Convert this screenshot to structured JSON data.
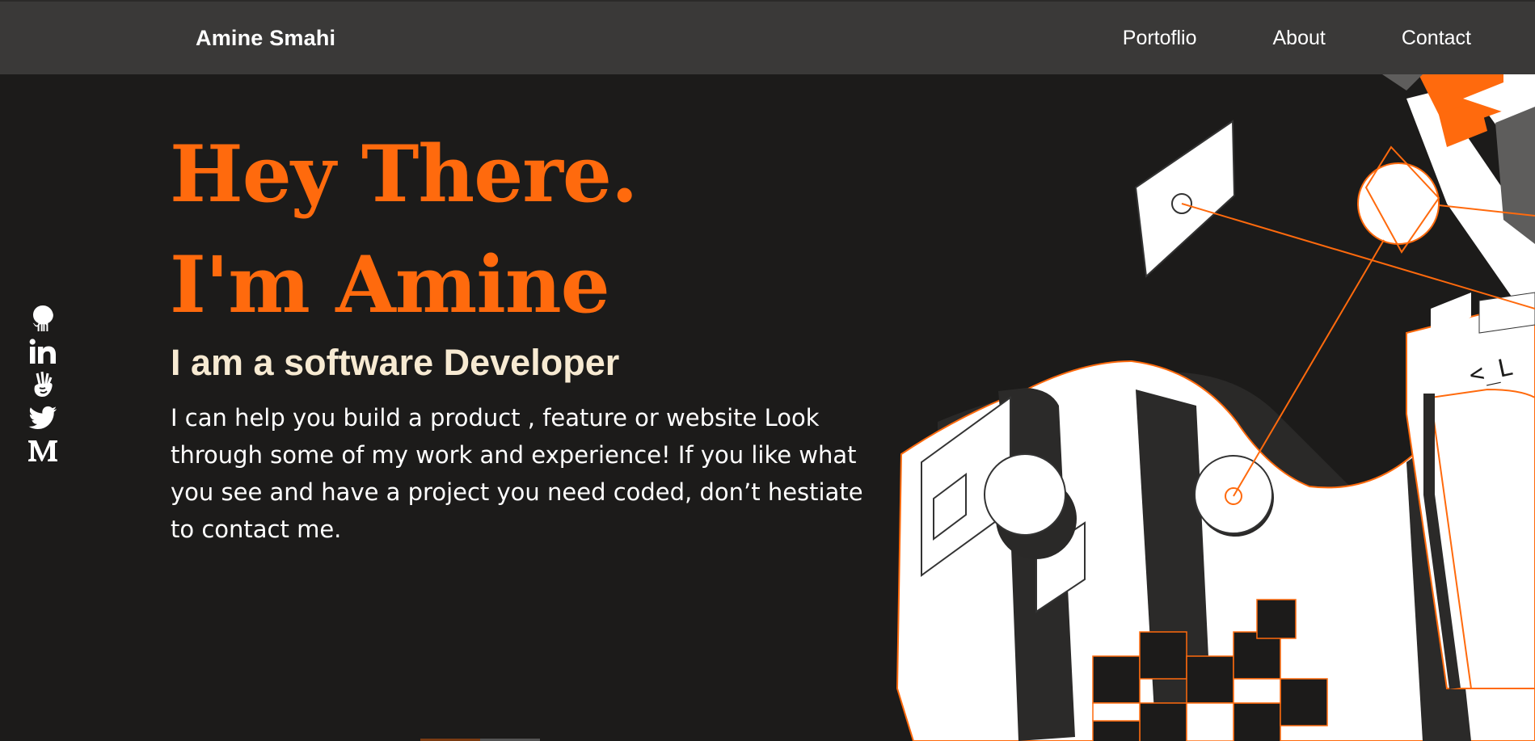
{
  "header": {
    "brand": "Amine Smahi",
    "nav": [
      {
        "label": "Portoflio"
      },
      {
        "label": "About"
      },
      {
        "label": "Contact"
      }
    ]
  },
  "social": [
    {
      "icon": "github-icon"
    },
    {
      "icon": "linkedin-icon"
    },
    {
      "icon": "angellist-icon"
    },
    {
      "icon": "twitter-icon"
    },
    {
      "icon": "medium-icon"
    }
  ],
  "hero": {
    "line1": "Hey There.",
    "line2": "I'm Amine",
    "subtitle": "I am a software Developer",
    "description": "I can help you build a product , feature or website Look through some of my work and experience! If you like what you see and have a project you need coded, don’t hestiate to contact me."
  },
  "colors": {
    "accent": "#ff6a0d",
    "background": "#1c1b1a",
    "navbar": "#3a3938",
    "subtitle": "#f7ead2"
  }
}
